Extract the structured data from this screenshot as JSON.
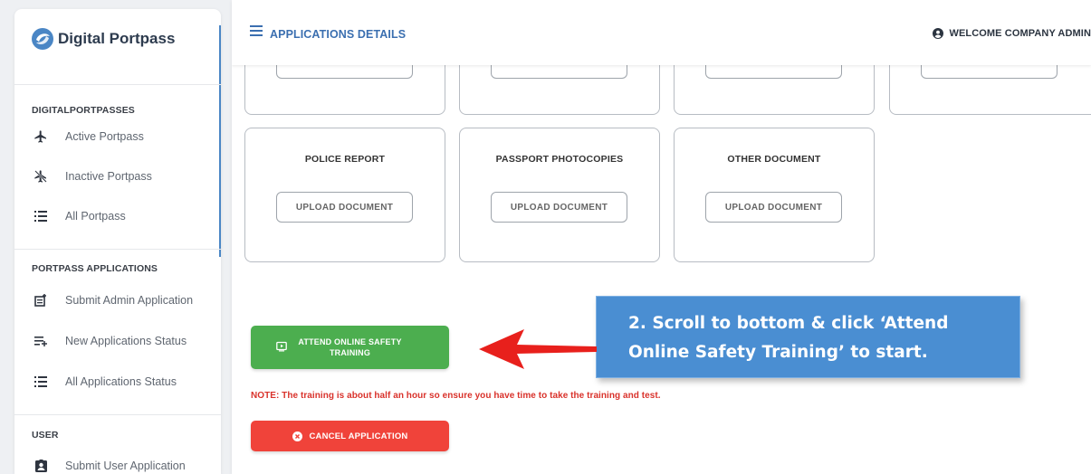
{
  "sidebar": {
    "brand": "Digital Portpass",
    "sections": [
      {
        "title": "DIGITALPORTPASSES",
        "items": [
          {
            "label": "Active Portpass",
            "icon": "airplane-icon"
          },
          {
            "label": "Inactive Portpass",
            "icon": "airplane-off-icon"
          },
          {
            "label": "All Portpass",
            "icon": "list-icon"
          }
        ]
      },
      {
        "title": "PORTPASS APPLICATIONS",
        "items": [
          {
            "label": "Submit Admin Application",
            "icon": "note-plus-icon"
          },
          {
            "label": "New Applications Status",
            "icon": "playlist-add-icon"
          },
          {
            "label": "All Applications Status",
            "icon": "list-icon"
          }
        ]
      },
      {
        "title": "USER",
        "items": [
          {
            "label": "Submit User Application",
            "icon": "id-badge-icon"
          }
        ]
      }
    ]
  },
  "header": {
    "title": "APPLICATIONS DETAILS",
    "welcome": "WELCOME COMPANY ADMIN"
  },
  "documents": [
    {
      "title": "POLICE REPORT",
      "button": "UPLOAD DOCUMENT"
    },
    {
      "title": "PASSPORT PHOTOCOPIES",
      "button": "UPLOAD DOCUMENT"
    },
    {
      "title": "OTHER DOCUMENT",
      "button": "UPLOAD DOCUMENT"
    }
  ],
  "actions": {
    "training_label": "ATTEND ONLINE SAFETY TRAINING",
    "note": "NOTE: The training is about half an hour so ensure you have time to take the training and test.",
    "cancel_label": "CANCEL APPLICATION"
  },
  "annotation": {
    "line1": "2. Scroll to bottom & click ‘Attend",
    "line2": "Online Safety Training’ to start."
  },
  "colors": {
    "accent": "#3b6fb0",
    "success": "#4cae4f",
    "danger": "#f0433a",
    "note": "#d9322b",
    "callout": "#4a8ed2",
    "arrow": "#e8201c"
  }
}
